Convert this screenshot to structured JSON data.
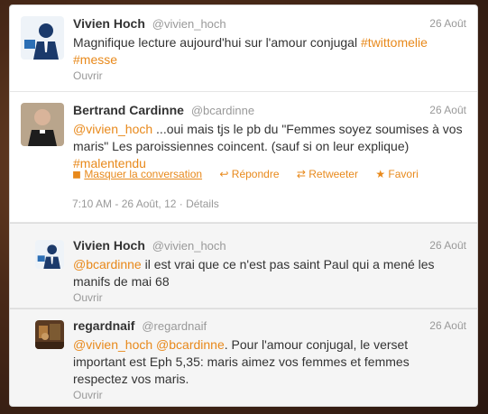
{
  "tweets": [
    {
      "name": "Vivien Hoch",
      "handle": "@vivien_hoch",
      "date": "26 Août",
      "text_plain": "Magnifique lecture aujourd'hui sur l'amour conjugal ",
      "tag1": "#twittomelie",
      "tag2": "#messe",
      "action": "Ouvrir"
    },
    {
      "name": "Bertrand Cardinne",
      "handle": "@bcardinne",
      "date": "26 Août",
      "mention": "@vivien_hoch",
      "text_plain": " ...oui mais tjs le pb du \"Femmes soyez soumises à vos maris\" Les paroissiennes coincent. (sauf si on leur explique)",
      "tag": "#malentendu",
      "collapse": "Masquer la conversation",
      "reply": "Répondre",
      "retweet": "Retweeter",
      "favorite": "Favori",
      "meta": "7:10 AM - 26 Août, 12 · Détails"
    },
    {
      "name": "Vivien Hoch",
      "handle": "@vivien_hoch",
      "date": "26 Août",
      "mention": "@bcardinne",
      "text_plain": " il est vrai que ce n'est pas saint Paul qui a mené les manifs de mai 68",
      "action": "Ouvrir"
    },
    {
      "name": "regardnaif",
      "handle": "@regardnaif",
      "date": "26 Août",
      "mention1": "@vivien_hoch",
      "mention2": "@bcardinne",
      "text_plain": ". Pour l'amour conjugal, le verset important est Eph 5,35: maris aimez vos femmes et femmes respectez vos maris.",
      "action": "Ouvrir"
    }
  ],
  "colors": {
    "accent": "#e8891b",
    "muted": "#999999",
    "text": "#333333"
  }
}
